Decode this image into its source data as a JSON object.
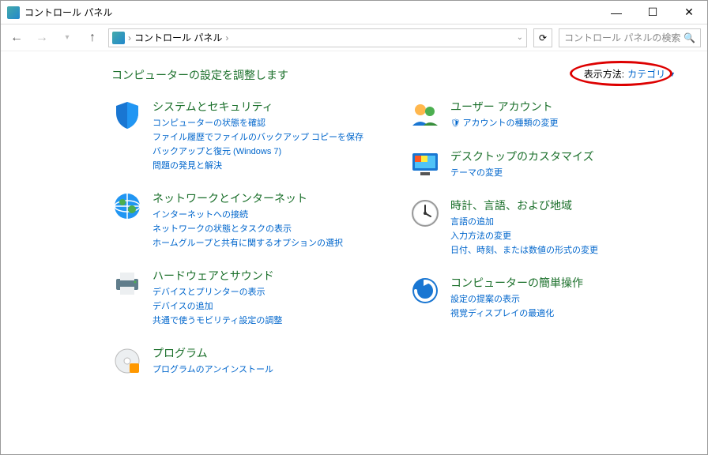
{
  "window": {
    "title": "コントロール パネル"
  },
  "addressbar": {
    "breadcrumb": "コントロール パネル",
    "search_placeholder": "コントロール パネルの検索"
  },
  "header": {
    "title": "コンピューターの設定を調整します",
    "view_label": "表示方法:",
    "view_value": "カテゴリ"
  },
  "categories": {
    "left": [
      {
        "title": "システムとセキュリティ",
        "links": [
          "コンピューターの状態を確認",
          "ファイル履歴でファイルのバックアップ コピーを保存",
          "バックアップと復元 (Windows 7)",
          "問題の発見と解決"
        ]
      },
      {
        "title": "ネットワークとインターネット",
        "links": [
          "インターネットへの接続",
          "ネットワークの状態とタスクの表示",
          "ホームグループと共有に関するオプションの選択"
        ]
      },
      {
        "title": "ハードウェアとサウンド",
        "links": [
          "デバイスとプリンターの表示",
          "デバイスの追加",
          "共通で使うモビリティ設定の調整"
        ]
      },
      {
        "title": "プログラム",
        "links": [
          "プログラムのアンインストール"
        ]
      }
    ],
    "right": [
      {
        "title": "ユーザー アカウント",
        "links": [
          "アカウントの種類の変更"
        ],
        "shield": true
      },
      {
        "title": "デスクトップのカスタマイズ",
        "links": [
          "テーマの変更"
        ]
      },
      {
        "title": "時計、言語、および地域",
        "links": [
          "言語の追加",
          "入力方法の変更",
          "日付、時刻、または数値の形式の変更"
        ]
      },
      {
        "title": "コンピューターの簡単操作",
        "links": [
          "設定の提案の表示",
          "視覚ディスプレイの最適化"
        ]
      }
    ]
  }
}
